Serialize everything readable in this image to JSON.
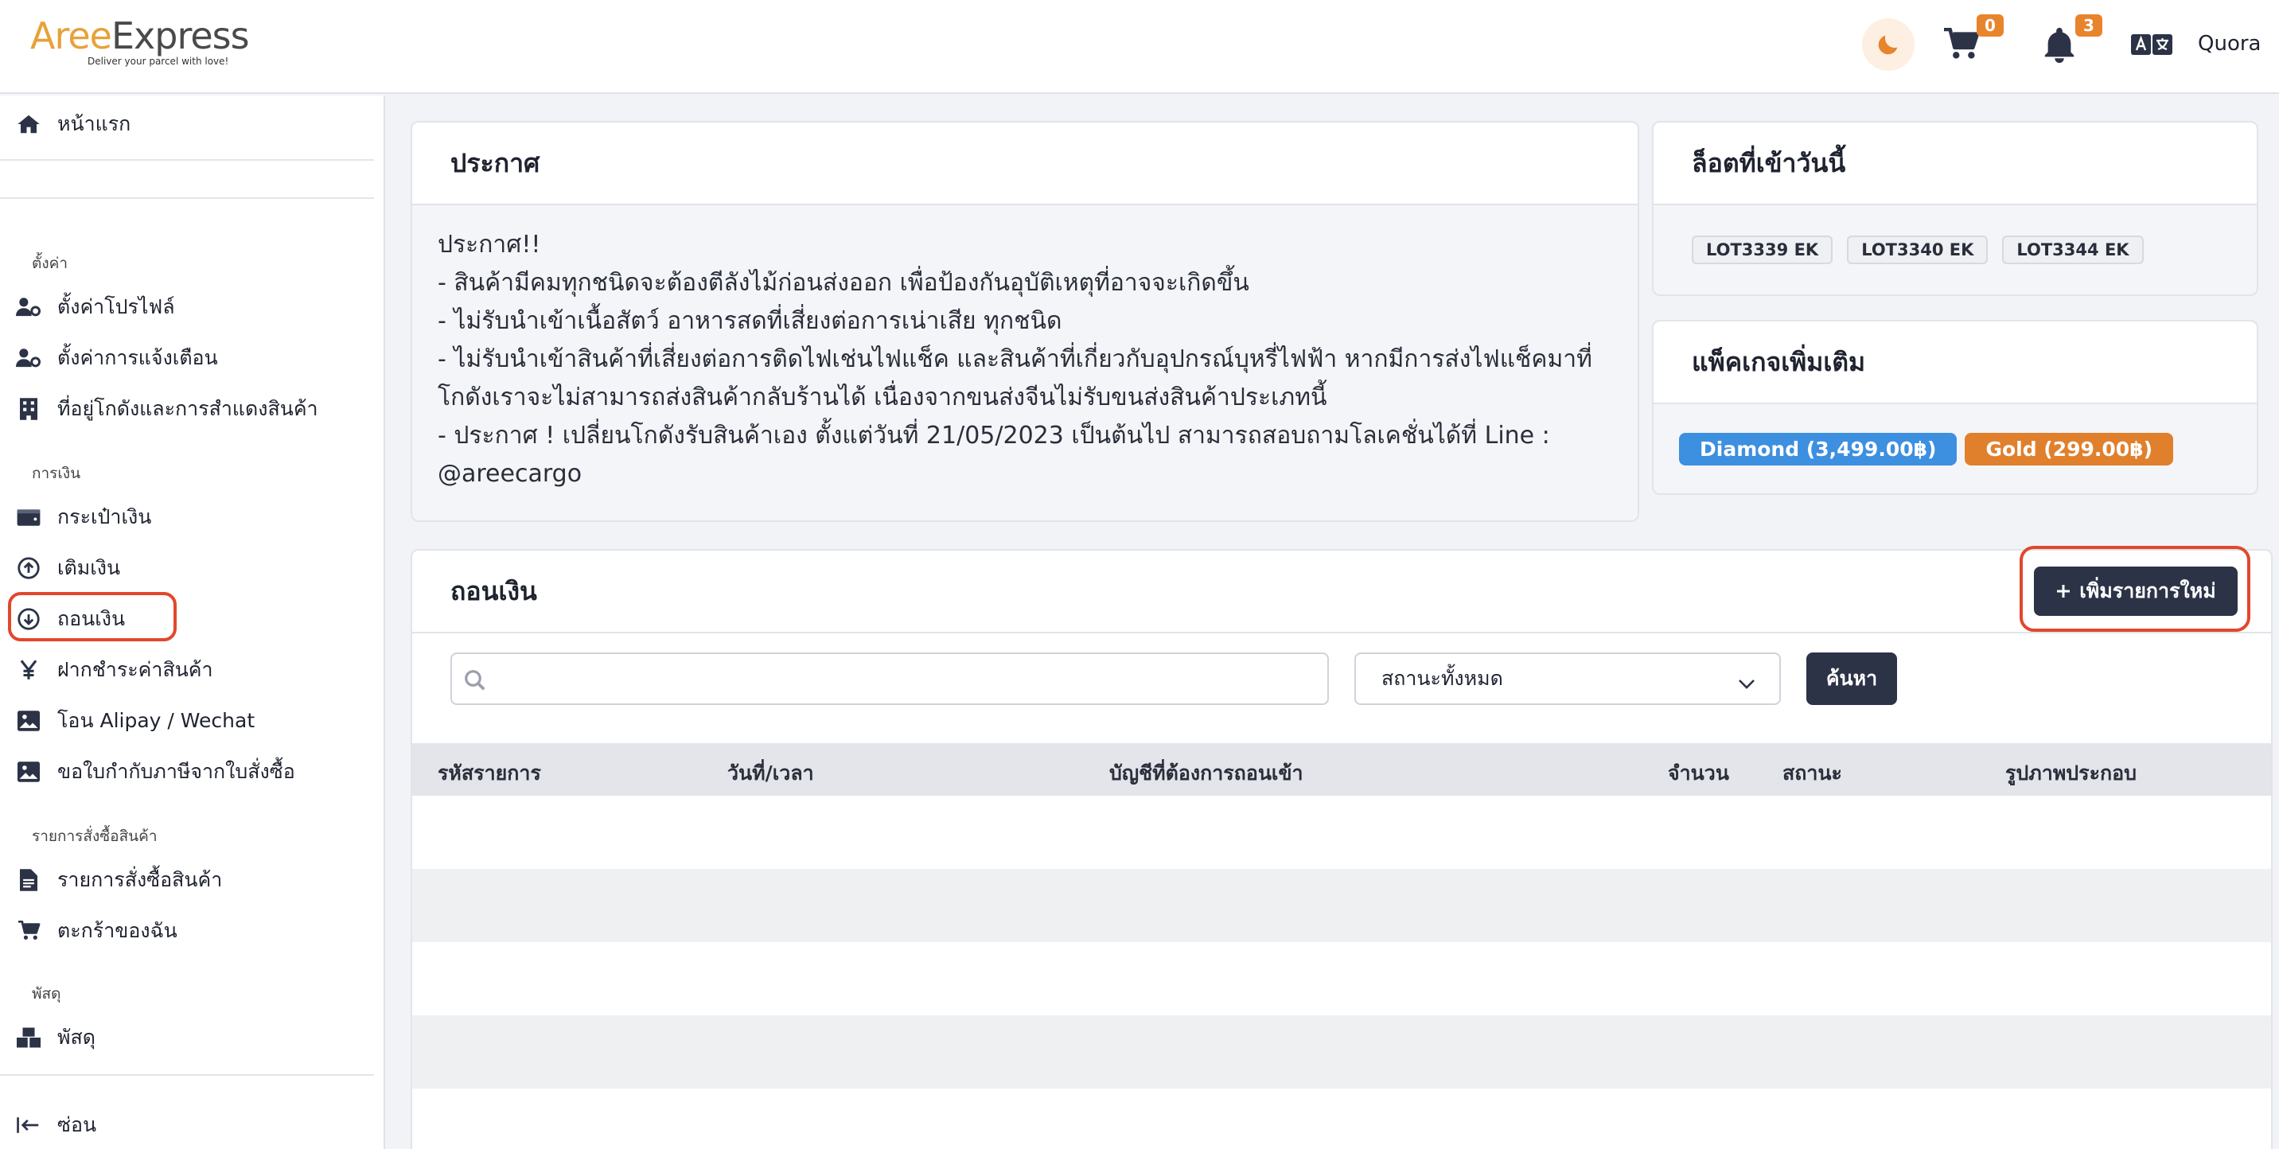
{
  "brand": {
    "name_a": "Aree",
    "name_b": "Express",
    "tagline": "Deliver your parcel with love!"
  },
  "header": {
    "cart_count": "0",
    "notif_count": "3",
    "user": "Quora",
    "accent": "#e8842c"
  },
  "sidebar": {
    "home": "หน้าแรก",
    "sections": {
      "settings": "ตั้งค่า",
      "money": "การเงิน",
      "orders": "รายการสั่งซื้อสินค้า",
      "parcel": "พัสดุ"
    },
    "items": {
      "profile": "ตั้งค่าโปรไฟล์",
      "notify": "ตั้งค่าการแจ้งเตือน",
      "address": "ที่อยู่โกดังและการสำแดงสินค้า",
      "wallet": "กระเป๋าเงิน",
      "topup": "เติมเงิน",
      "withdraw": "ถอนเงิน",
      "pay": "ฝากชำระค่าสินค้า",
      "alipay": "โอน Alipay / Wechat",
      "tax": "ขอใบกำกับภาษีจากใบสั่งซื้อ",
      "order_list": "รายการสั่งซื้อสินค้า",
      "cart": "ตะกร้าของฉัน",
      "parcel": "พัสดุ"
    },
    "hide": "ซ่อน"
  },
  "announcement": {
    "title": "ประกาศ",
    "lines": [
      "ประกาศ!!",
      "- สินค้ามีคมทุกชนิดจะต้องตีลังไม้ก่อนส่งออก เพื่อป้องกันอุบัติเหตุที่อาจจะเกิดขึ้น",
      "- ไม่รับนำเข้าเนื้อสัตว์ อาหารสดที่เสี่ยงต่อการเน่าเสีย ทุกชนิด",
      "- ไม่รับนำเข้าสินค้าที่เสี่ยงต่อการติดไฟเช่นไฟแช็ค และสินค้าที่เกี่ยวกับอุปกรณ์บุหรี่ไฟฟ้า หากมีการส่งไฟแช็คมาที่",
      "โกดังเราจะไม่สามารถส่งสินค้ากลับร้านได้ เนื่องจากขนส่งจีนไม่รับขนส่งสินค้าประเภทนี้",
      "- ประกาศ ! เปลี่ยนโกดังรับสินค้าเอง ตั้งแต่วันที่ 21/05/2023 เป็นต้นไป สามารถสอบถามโลเคชั่นได้ที่ Line :",
      "@areecargo"
    ]
  },
  "lots_today": {
    "title": "ล็อตที่เข้าวันนี้",
    "lots": [
      "LOT3339 EK",
      "LOT3340 EK",
      "LOT3344 EK"
    ]
  },
  "packages": {
    "title": "แพ็คเกจเพิ่มเติม",
    "items": [
      {
        "label": "Diamond (3,499.00฿)",
        "color": "#3d8fe0"
      },
      {
        "label": "Gold (299.00฿)",
        "color": "#e0802c"
      }
    ]
  },
  "withdraw": {
    "title": "ถอนเงิน",
    "add_button": "เพิ่มรายการใหม่",
    "search_placeholder": "",
    "status_select": "สถานะทั้งหมด",
    "search_button": "ค้นหา",
    "columns": [
      "รหัสรายการ",
      "วันที่/เวลา",
      "บัญชีที่ต้องการถอนเข้า",
      "จำนวน",
      "สถานะ",
      "รูปภาพประกอบ"
    ]
  }
}
